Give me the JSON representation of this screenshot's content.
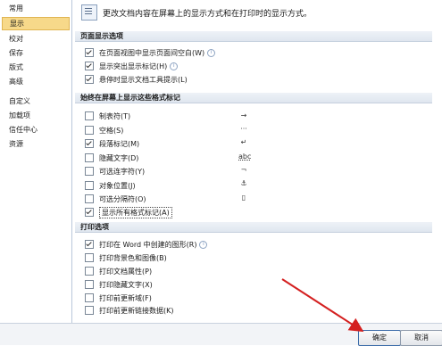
{
  "sidebar": {
    "items": [
      {
        "label": "常用"
      },
      {
        "label": "显示"
      },
      {
        "label": "校对"
      },
      {
        "label": "保存"
      },
      {
        "label": "版式"
      },
      {
        "label": "高级"
      },
      {
        "label": "自定义"
      },
      {
        "label": "加载项"
      },
      {
        "label": "信任中心"
      },
      {
        "label": "资源"
      }
    ]
  },
  "header": {
    "text": "更改文档内容在屏幕上的显示方式和在打印时的显示方式。"
  },
  "sections": {
    "page_display": {
      "title": "页面显示选项",
      "items": [
        {
          "label": "在页面视图中显示页面间空白(W)",
          "checked": true,
          "info": true
        },
        {
          "label": "显示突出显示标记(H)",
          "checked": true,
          "info": true
        },
        {
          "label": "悬停时显示文档工具提示(L)",
          "checked": true,
          "info": false
        }
      ]
    },
    "format_marks": {
      "title": "始终在屏幕上显示这些格式标记",
      "items": [
        {
          "label": "制表符(T)",
          "checked": false,
          "mark": "→"
        },
        {
          "label": "空格(S)",
          "checked": false,
          "mark": "···"
        },
        {
          "label": "段落标记(M)",
          "checked": true,
          "mark": "↵"
        },
        {
          "label": "隐藏文字(D)",
          "checked": false,
          "mark": "abc"
        },
        {
          "label": "可选连字符(Y)",
          "checked": false,
          "mark": "¬"
        },
        {
          "label": "对象位置(J)",
          "checked": false,
          "mark": "⚓"
        },
        {
          "label": "可选分隔符(O)",
          "checked": false,
          "mark": "▯"
        },
        {
          "label": "显示所有格式标记(A)",
          "checked": true,
          "mark": ""
        }
      ]
    },
    "print": {
      "title": "打印选项",
      "items": [
        {
          "label": "打印在 Word 中创建的图形(R)",
          "checked": true,
          "info": true
        },
        {
          "label": "打印背景色和图像(B)",
          "checked": false
        },
        {
          "label": "打印文档属性(P)",
          "checked": false
        },
        {
          "label": "打印隐藏文字(X)",
          "checked": false
        },
        {
          "label": "打印前更新域(F)",
          "checked": false
        },
        {
          "label": "打印前更新链接数据(K)",
          "checked": false
        }
      ]
    }
  },
  "footer": {
    "ok_label": "确定",
    "cancel_label": "取消"
  },
  "colors": {
    "active_sidebar": "#f7d98a",
    "arrow": "#d42020"
  }
}
